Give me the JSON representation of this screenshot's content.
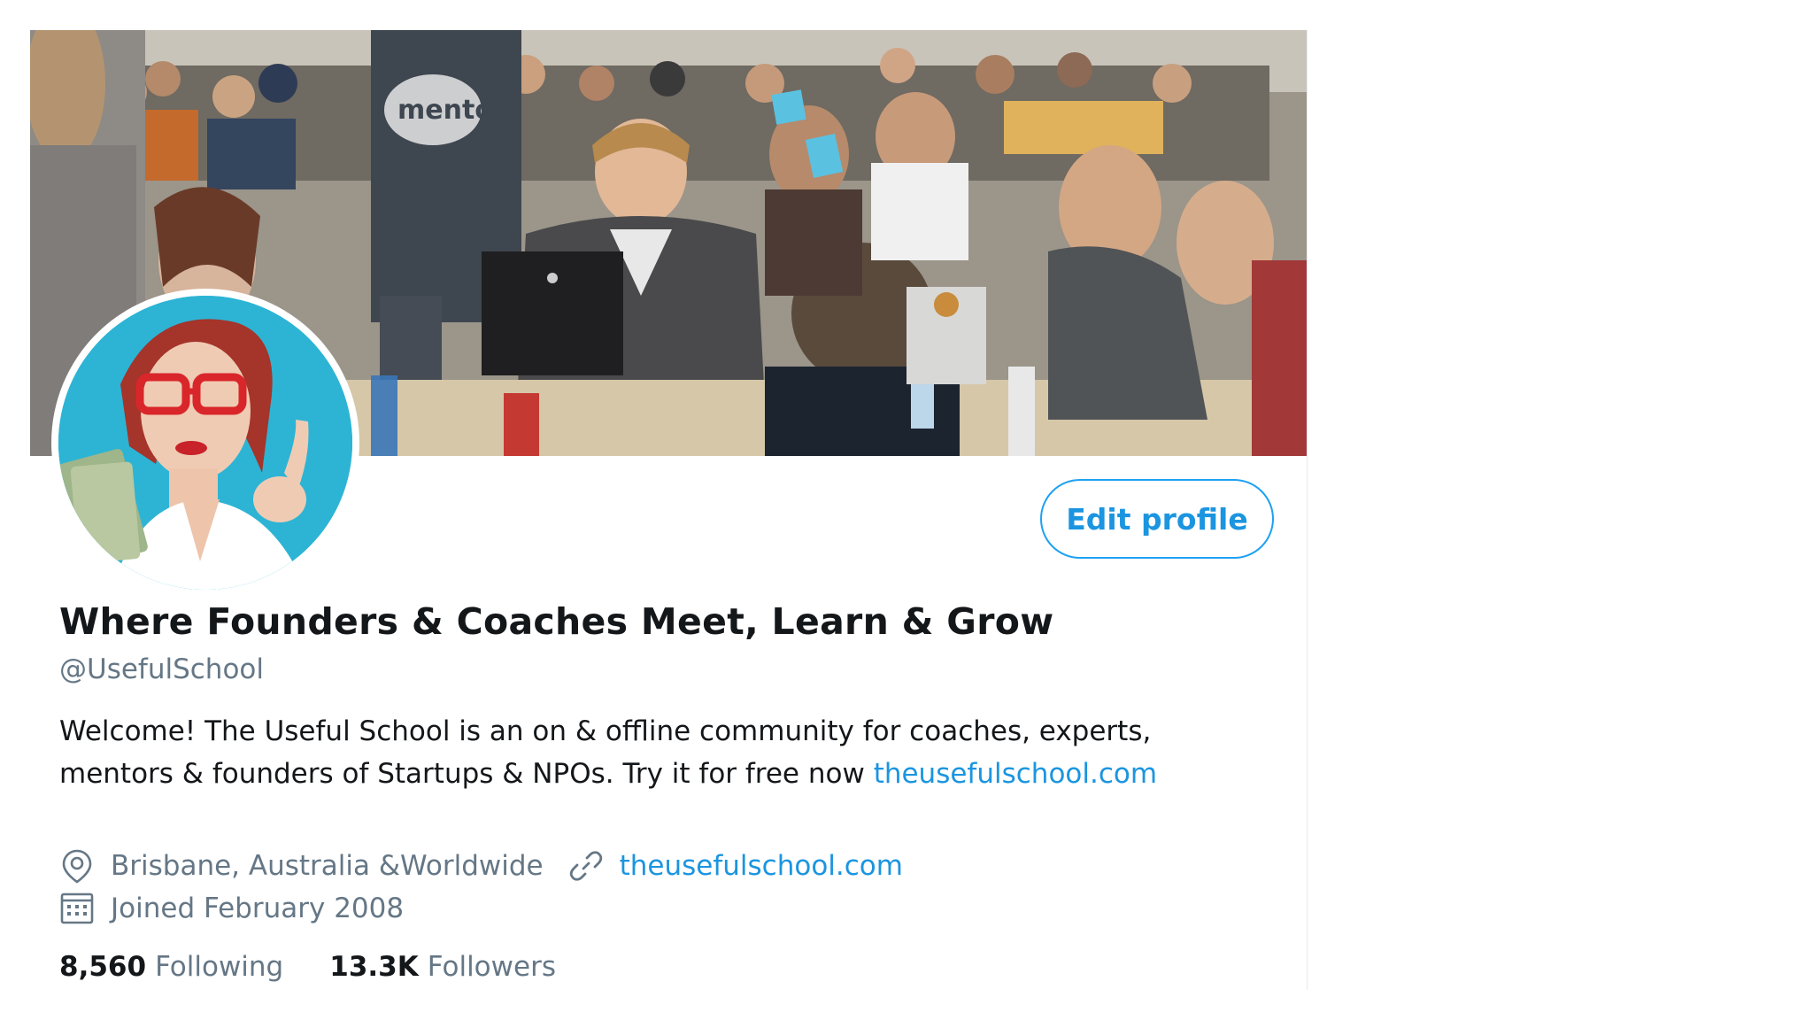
{
  "profile": {
    "display_name": "Where Founders & Coaches Meet, Learn & Grow",
    "handle": "@UsefulSchool",
    "edit_button_label": "Edit profile",
    "bio": {
      "line1": "Welcome! The Useful School is an on & offline community for coaches, experts,",
      "line2_text": "mentors & founders of Startups & NPOs. Try it for free now ",
      "line2_link": "theusefulschool.com"
    },
    "location": "Brisbane, Australia &Worldwide",
    "website": "theusefulschool.com",
    "joined": "Joined February 2008",
    "stats": {
      "following_count": "8,560",
      "following_label": "Following",
      "followers_count": "13.3K",
      "followers_label": "Followers"
    },
    "icons": {
      "location": "location-pin-icon",
      "website": "link-icon",
      "joined": "calendar-icon"
    },
    "colors": {
      "accent": "#1b95e0",
      "secondary_text": "#657786",
      "primary_text": "#14171a"
    }
  },
  "banner": {
    "laptop_sticker_text": "mentor"
  }
}
